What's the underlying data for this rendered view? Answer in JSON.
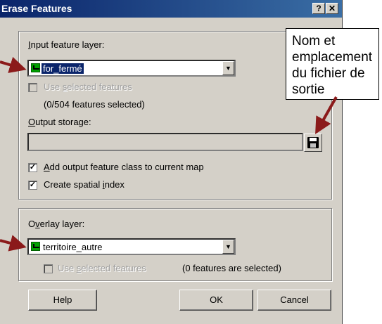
{
  "window": {
    "title": "Erase Features",
    "help_glyph": "?",
    "close_glyph": "✕"
  },
  "input_group": {
    "layer_label_prefix": "",
    "layer_label_u": "I",
    "layer_label_rest": "nput feature layer:",
    "layer_value": "for_fermé",
    "use_selected_pre": "Use ",
    "use_selected_u": "s",
    "use_selected_rest": "elected features",
    "selection_count": "(0/504 features selected)",
    "output_label_u": "O",
    "output_label_rest": "utput storage:",
    "output_value": "",
    "add_output_pre": "",
    "add_output_u": "A",
    "add_output_rest": "dd output feature class to current map",
    "add_output_checked": true,
    "spatial_index_pre": "Create spatial ",
    "spatial_index_u": "i",
    "spatial_index_rest": "ndex",
    "spatial_index_checked": true
  },
  "overlay_group": {
    "label_pre": "O",
    "label_u": "v",
    "label_rest": "erlay layer:",
    "layer_value": "territoire_autre",
    "use_selected_pre": "Use ",
    "use_selected_u": "s",
    "use_selected_rest": "elected features",
    "selection_count": "(0 features are selected)"
  },
  "buttons": {
    "help": "Help",
    "ok": "OK",
    "cancel": "Cancel"
  },
  "callout": {
    "lines": [
      "Nom et",
      "emplacement",
      "du fichier de",
      "sortie"
    ]
  },
  "colors": {
    "arrow": "#8b1a1a",
    "titlebar": "#0a246a",
    "dialog_bg": "#d4d0c8"
  },
  "icons": {
    "layer": "layer-icon",
    "save": "floppy-disk-icon",
    "dropdown": "chevron-down-icon"
  }
}
